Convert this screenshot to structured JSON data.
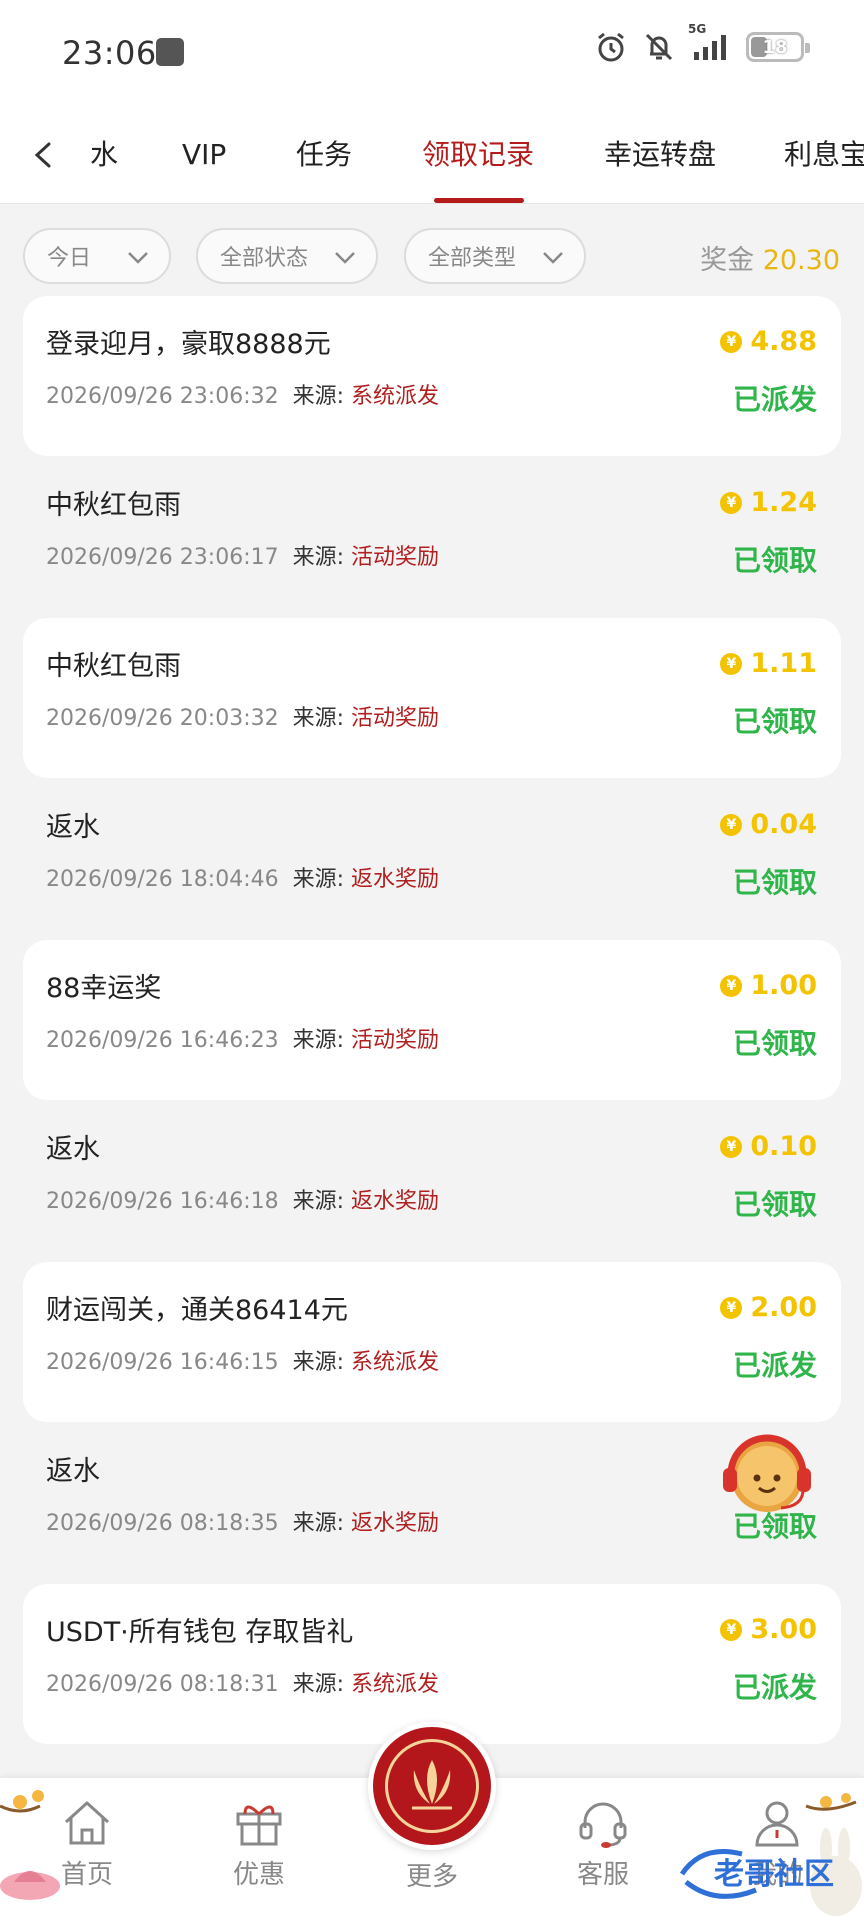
{
  "status_bar": {
    "time": "23:06",
    "network": "5G",
    "battery": "18"
  },
  "tabs": [
    {
      "label": "水"
    },
    {
      "label": "VIP"
    },
    {
      "label": "任务"
    },
    {
      "label": "领取记录",
      "active": true
    },
    {
      "label": "幸运转盘"
    },
    {
      "label": "利息宝"
    }
  ],
  "filters": {
    "date": "今日",
    "status": "全部状态",
    "type": "全部类型",
    "bonus_label": "奖金",
    "bonus_value": "20.30"
  },
  "source_label": "来源:",
  "coin_symbol": "¥",
  "records": [
    {
      "title": "登录迎月，豪取8888元",
      "time": "2026/09/26 23:06:32",
      "source": "系统派发",
      "amount": "4.88",
      "status": "已派发"
    },
    {
      "title": "中秋红包雨",
      "time": "2026/09/26 23:06:17",
      "source": "活动奖励",
      "amount": "1.24",
      "status": "已领取"
    },
    {
      "title": "中秋红包雨",
      "time": "2026/09/26 20:03:32",
      "source": "活动奖励",
      "amount": "1.11",
      "status": "已领取"
    },
    {
      "title": "返水",
      "time": "2026/09/26 18:04:46",
      "source": "返水奖励",
      "amount": "0.04",
      "status": "已领取"
    },
    {
      "title": "88幸运奖",
      "time": "2026/09/26 16:46:23",
      "source": "活动奖励",
      "amount": "1.00",
      "status": "已领取"
    },
    {
      "title": "返水",
      "time": "2026/09/26 16:46:18",
      "source": "返水奖励",
      "amount": "0.10",
      "status": "已领取"
    },
    {
      "title": "财运闯关，通关86414元",
      "time": "2026/09/26 16:46:15",
      "source": "系统派发",
      "amount": "2.00",
      "status": "已派发"
    },
    {
      "title": "返水",
      "time": "2026/09/26 08:18:35",
      "source": "返水奖励",
      "amount": "",
      "status": "已领取"
    },
    {
      "title": "USDT·所有钱包 存取皆礼",
      "time": "2026/09/26 08:18:31",
      "source": "系统派发",
      "amount": "3.00",
      "status": "已派发"
    }
  ],
  "bottom_nav": {
    "home": "首页",
    "promo": "优惠",
    "more": "更多",
    "support": "客服",
    "mine": "我的"
  },
  "watermark": "老哥社区",
  "colors": {
    "accent": "#b51b1b",
    "gold": "#f4c300",
    "success": "#2fb54a"
  }
}
